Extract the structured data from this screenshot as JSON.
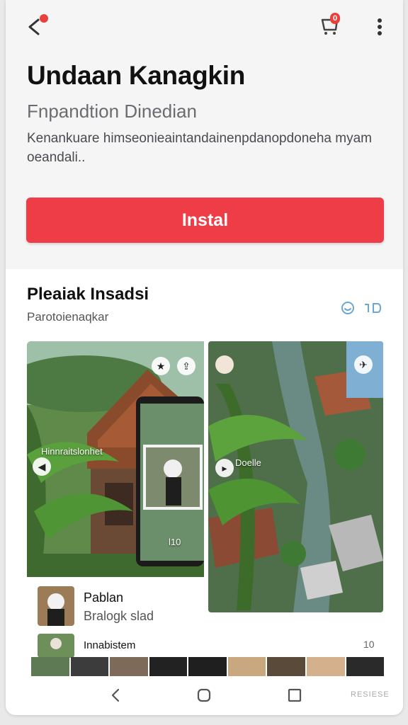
{
  "header": {
    "icons": [
      "back-arrow-icon",
      "cart-icon",
      "more-vertical-icon"
    ],
    "cart_badge": "0"
  },
  "app": {
    "title": "Undaan Kanagkin",
    "subtitle": "Fnpandtion Dinedian",
    "description": "Kenankuare himseonieaintandainenpdanopdoneha myam oeandali..",
    "install_label": "Instal"
  },
  "section": {
    "title": "Pleaiak Insadsi",
    "subtitle": "Parotoienaqkar",
    "icons": [
      "refresh-icon",
      "toggle-icon"
    ]
  },
  "gallery": {
    "left_overlay": "Hinnraitslonhet",
    "right_overlay": "Doelle",
    "phone_counter": "l10"
  },
  "list": [
    {
      "title": "Pablan",
      "subtitle": "Bralogk slad"
    },
    {
      "title": "Innabistem",
      "subtitle": ""
    }
  ],
  "bottom_counter": "10",
  "navbar": {
    "icons": [
      "back-nav-icon",
      "home-nav-icon",
      "recents-nav-icon"
    ],
    "label": "RESIESE"
  },
  "colors": {
    "accent": "#ef3d47",
    "notification": "#e8403c",
    "icon_blue": "#6aa7d6"
  }
}
